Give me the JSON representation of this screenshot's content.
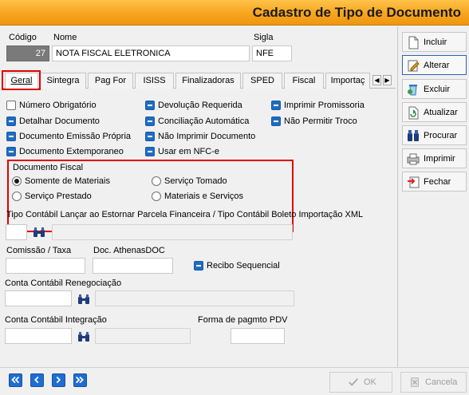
{
  "window": {
    "title": "Cadastro de Tipo de Documento"
  },
  "header": {
    "codigo_label": "Código",
    "codigo_value": "27",
    "nome_label": "Nome",
    "nome_value": "NOTA FISCAL ELETRONICA",
    "sigla_label": "Sigla",
    "sigla_value": "NFE"
  },
  "tabs": [
    {
      "label": "Geral",
      "active": true
    },
    {
      "label": "Sintegra"
    },
    {
      "label": "Pag For"
    },
    {
      "label": "ISISS"
    },
    {
      "label": "Finalizadoras"
    },
    {
      "label": "SPED"
    },
    {
      "label": "Fiscal"
    },
    {
      "label": "Importaç"
    }
  ],
  "checkboxes": {
    "col1": [
      {
        "label": "Número Obrigatório",
        "checked": false
      },
      {
        "label": "Detalhar Documento",
        "checked": true
      },
      {
        "label": "Documento Emissão Própria",
        "checked": true
      },
      {
        "label": "Documento Extemporaneo",
        "checked": true
      }
    ],
    "col2": [
      {
        "label": "Devolução Requerida",
        "checked": true
      },
      {
        "label": "Conciliação Automática",
        "checked": true
      },
      {
        "label": "Não Imprimir Documento",
        "checked": true
      },
      {
        "label": "Usar em NFC-e",
        "checked": true
      }
    ],
    "col3": [
      {
        "label": "Imprimir Promissoria",
        "checked": true
      },
      {
        "label": "Não Permitir Troco",
        "checked": true
      }
    ]
  },
  "documento_fiscal": {
    "title": "Documento Fiscal",
    "options": [
      {
        "label": "Somente de Materiais",
        "selected": true
      },
      {
        "label": "Serviço Tomado",
        "selected": false
      },
      {
        "label": "Serviço Prestado",
        "selected": false
      },
      {
        "label": "Materiais e Serviços",
        "selected": false
      }
    ]
  },
  "fields": {
    "tipo_contabil_label": "Tipo Contábil Lançar ao Estornar Parcela Financeira / Tipo Contábil Boleto Importação XML",
    "tipo_contabil_value": "",
    "comissao_label": "Comissão / Taxa",
    "comissao_value": "",
    "doc_athenas_label": "Doc. AthenasDOC",
    "doc_athenas_value": "",
    "recibo_label": "Recibo Sequencial",
    "recibo_checked": true,
    "conta_reneg_label": "Conta Contábil Renegociação",
    "conta_reneg_value": "",
    "conta_integ_label": "Conta Contábil Integração",
    "conta_integ_value": "",
    "forma_pagto_label": "Forma de pagmto PDV",
    "forma_pagto_value": ""
  },
  "side_buttons": [
    {
      "label": "Incluir",
      "icon": "new-document-icon"
    },
    {
      "label": "Alterar",
      "icon": "edit-icon"
    },
    {
      "label": "Excluir",
      "icon": "delete-icon"
    },
    {
      "label": "Atualizar",
      "icon": "refresh-icon"
    },
    {
      "label": "Procurar",
      "icon": "binoculars-icon"
    },
    {
      "label": "Imprimir",
      "icon": "printer-icon"
    },
    {
      "label": "Fechar",
      "icon": "close-icon"
    }
  ],
  "bottom": {
    "nav_icons": [
      "first-record-icon",
      "prev-record-icon",
      "next-record-icon",
      "last-record-icon"
    ],
    "ok_label": "OK",
    "cancel_label": "Cancela"
  },
  "colors": {
    "title_bar": "#f7a51e",
    "check_blue": "#1e6dc2",
    "highlight_red": "#e00000",
    "nav_blue": "#1f6dd3"
  }
}
